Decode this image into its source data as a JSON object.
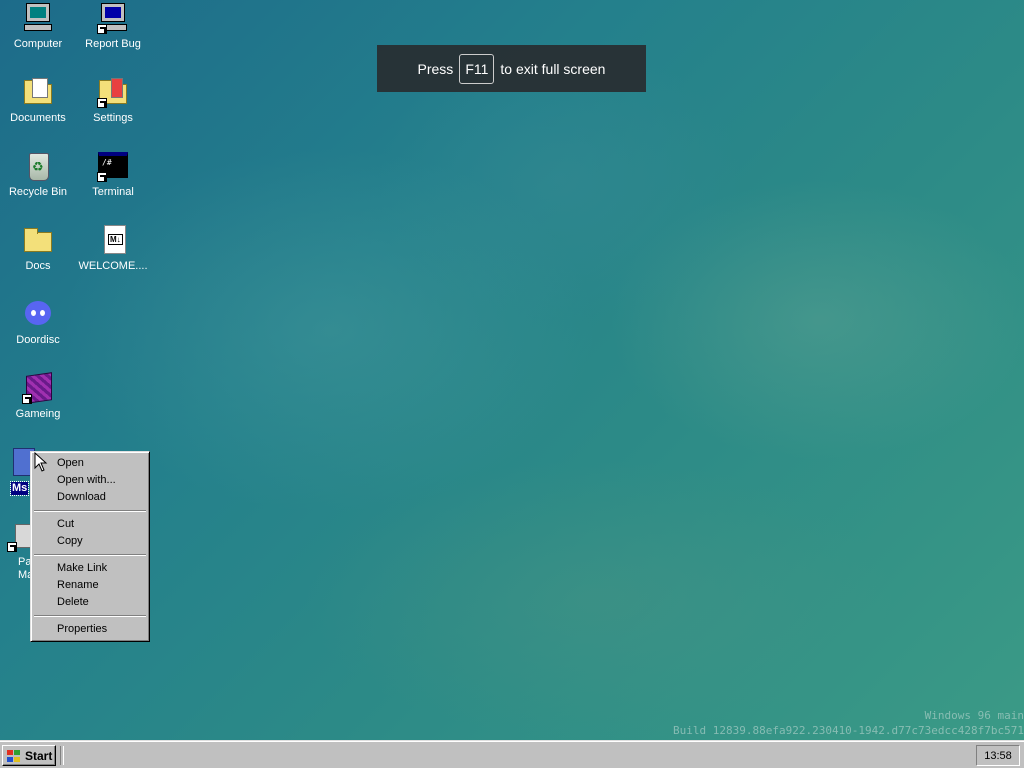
{
  "desktop": {
    "icons": [
      {
        "label": "Computer",
        "icon": "computer-icon"
      },
      {
        "label": "Report Bug",
        "icon": "report-bug-icon"
      },
      {
        "label": "Documents",
        "icon": "documents-folder-icon"
      },
      {
        "label": "Settings",
        "icon": "settings-folder-icon"
      },
      {
        "label": "Recycle Bin",
        "icon": "recycle-bin-icon"
      },
      {
        "label": "Terminal",
        "icon": "terminal-icon"
      },
      {
        "label": "Docs",
        "icon": "folder-icon"
      },
      {
        "label": "WELCOME....",
        "icon": "markdown-file-icon"
      },
      {
        "label": "Doordisc",
        "icon": "discord-icon"
      },
      {
        "label": "Gameing",
        "icon": "cube-icon"
      },
      {
        "label": "Ms",
        "icon": "app-icon"
      },
      {
        "label": "Pa Ma",
        "icon": "package-manager-icon"
      }
    ]
  },
  "toast": {
    "prefix": "Press",
    "key": "F11",
    "suffix": "to exit full screen"
  },
  "context_menu": {
    "items": [
      "Open",
      "Open with...",
      "Download",
      "Cut",
      "Copy",
      "Make Link",
      "Rename",
      "Delete",
      "Properties"
    ]
  },
  "watermark": {
    "line1": "Windows 96 main",
    "line2": "Build 12839.88efa922.230410-1942.d77c73edcc428f7bc571"
  },
  "taskbar": {
    "start_label": "Start",
    "clock": "13:58"
  },
  "colors": {
    "desktop_teal": "#24808c",
    "menu_gray": "#c0c0c0",
    "selection_navy": "#000080"
  }
}
